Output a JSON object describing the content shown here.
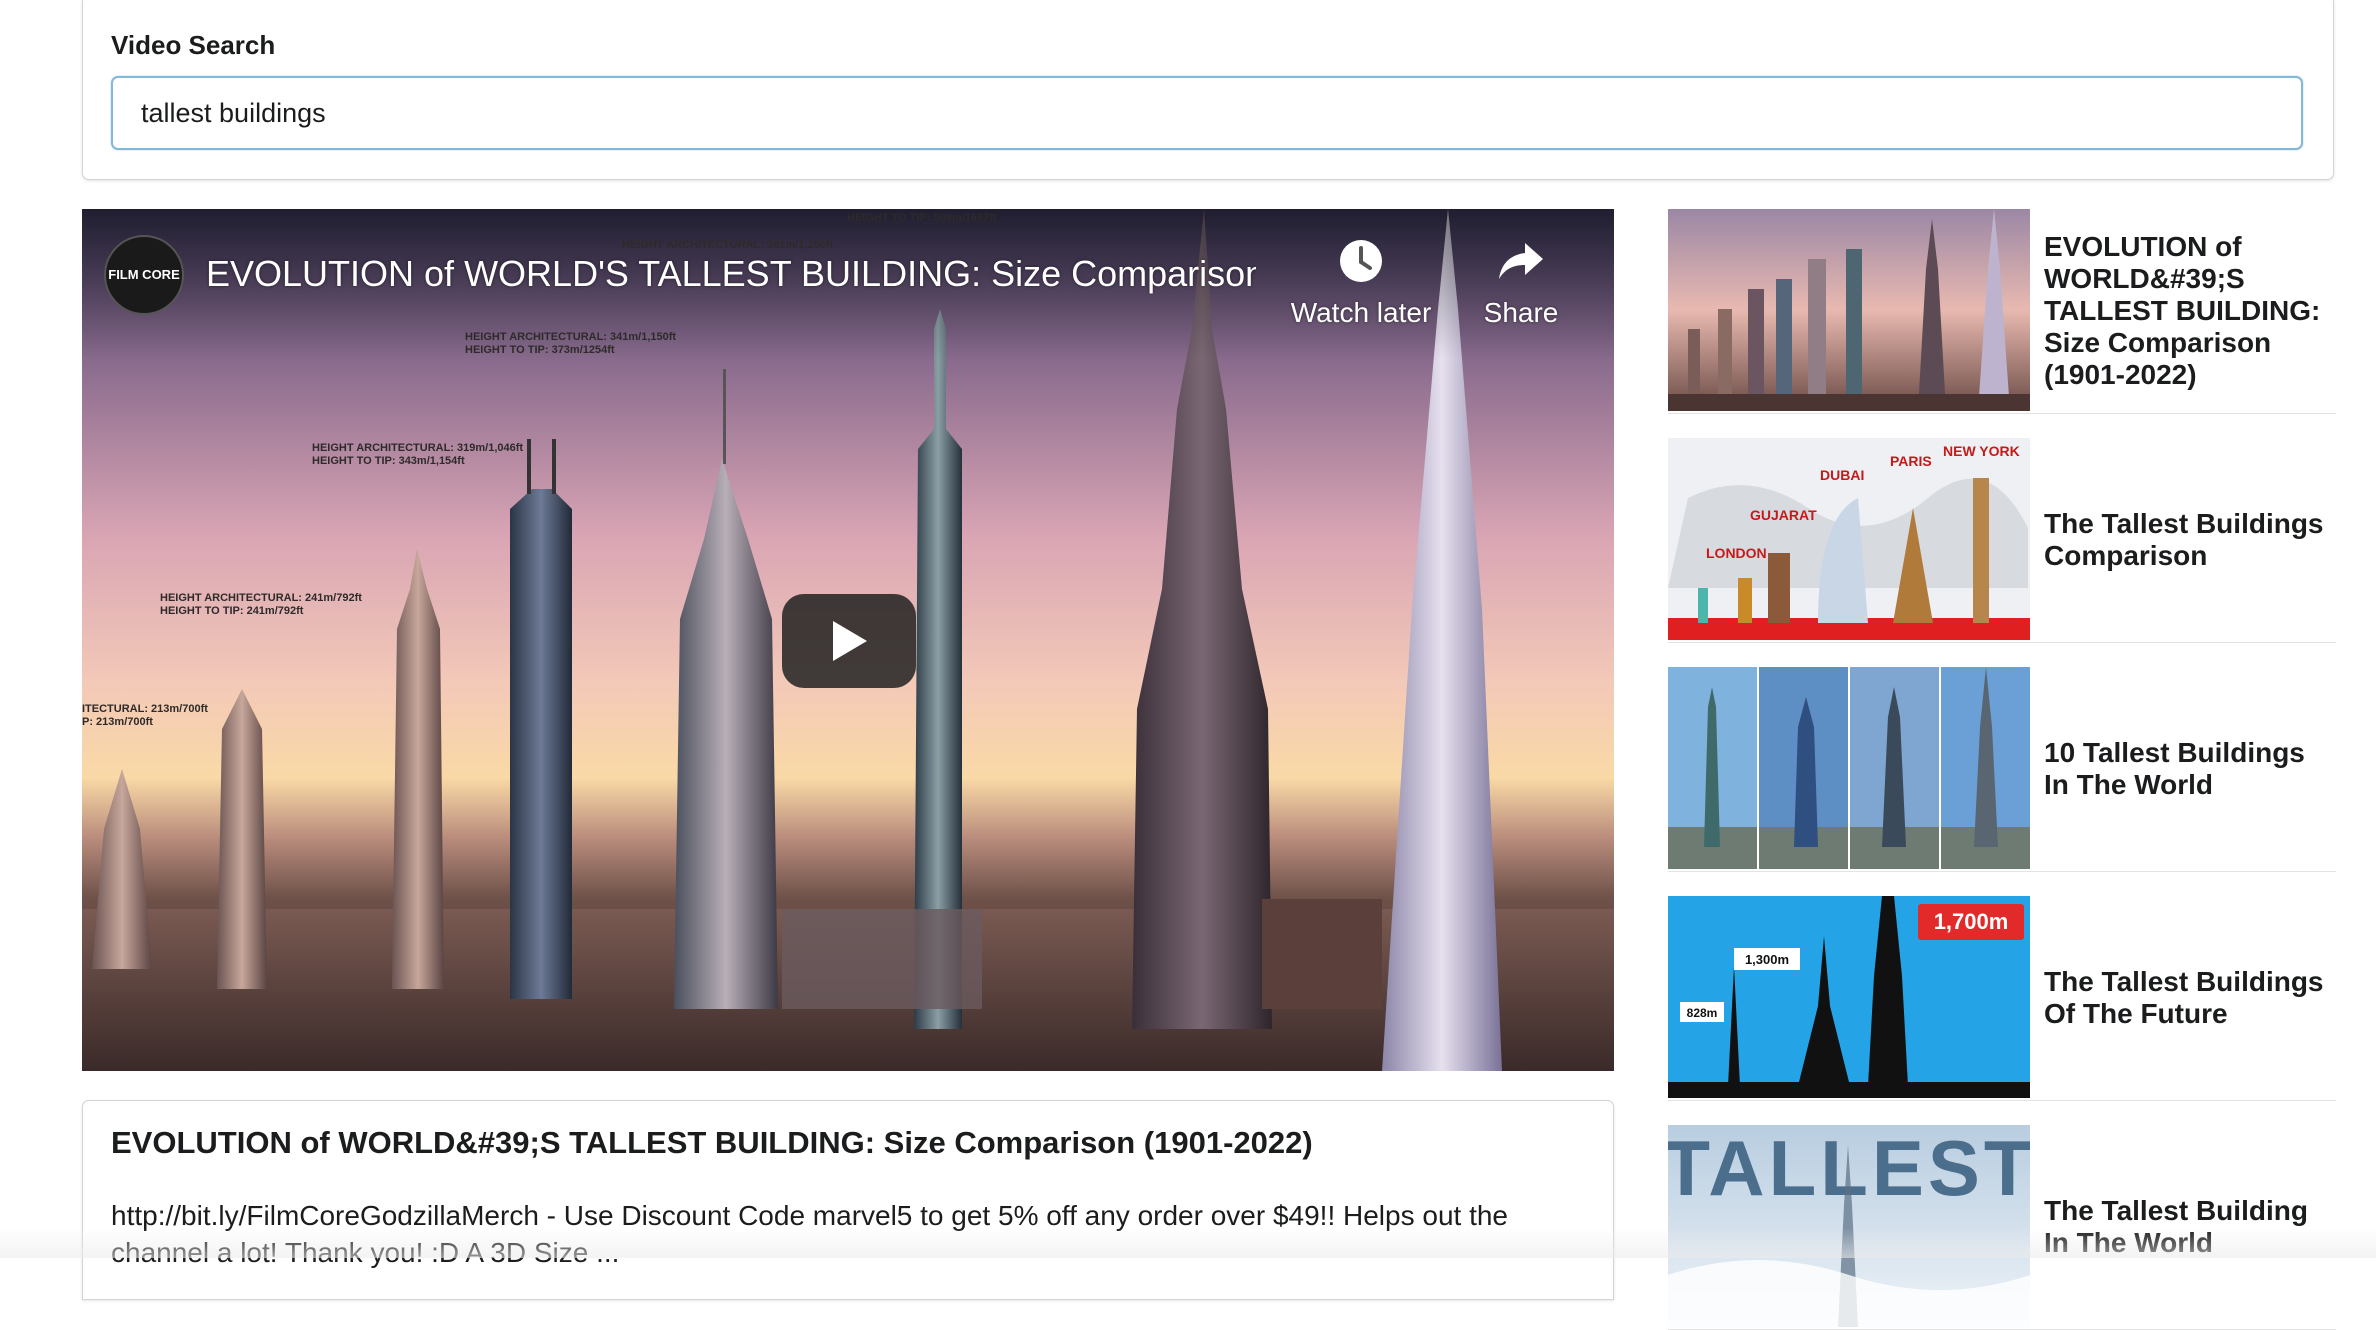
{
  "search": {
    "label": "Video Search",
    "value": "tallest buildings"
  },
  "player": {
    "title": "EVOLUTION of WORLD'S TALLEST BUILDING: Size Comparison (...",
    "channel_avatar_text": "FILM CORE",
    "watch_later_label": "Watch later",
    "share_label": "Share",
    "icons": {
      "watch_later": "clock-icon",
      "share": "share-arrow-icon",
      "play": "play-icon"
    },
    "annotations": [
      "HEIGHT TO TIP: 508m/1667ft",
      "HEIGHT ARCHITECTURAL: 381m/1,250ft",
      "HEIGHT ARCHITECTURAL: 341m/1,150ft\nHEIGHT TO TIP: 373m/1254ft",
      "HEIGHT ARCHITECTURAL: 319m/1,046ft\nHEIGHT TO TIP: 343m/1,154ft",
      "HEIGHT ARCHITECTURAL: 241m/792ft\nHEIGHT TO TIP: 241m/792ft",
      "ITECTURAL: 213m/700ft\nP: 213m/700ft"
    ]
  },
  "details": {
    "title": "EVOLUTION of WORLD&#39;S TALLEST BUILDING: Size Comparison (1901-2022)",
    "description": "http://bit.ly/FilmCoreGodzillaMerch - Use Discount Code marvel5 to get 5% off any order over $49!! Helps out the channel a lot! Thank you! :D A 3D Size ..."
  },
  "videos": [
    {
      "title": "EVOLUTION of WORLD&#39;S TALLEST BUILDING: Size Comparison (1901-2022)"
    },
    {
      "title": "The Tallest Buildings Comparison",
      "thumb_labels": [
        "NEW YORK",
        "PARIS",
        "DUBAI",
        "GUJARAT",
        "LONDON"
      ]
    },
    {
      "title": "10 Tallest Buildings In The World"
    },
    {
      "title": "The Tallest Buildings Of The Future",
      "thumb_labels": [
        "1,700m",
        "1,300m",
        "828m"
      ]
    },
    {
      "title": "The Tallest Building In The World",
      "thumb_labels": [
        "TALLEST"
      ]
    }
  ]
}
